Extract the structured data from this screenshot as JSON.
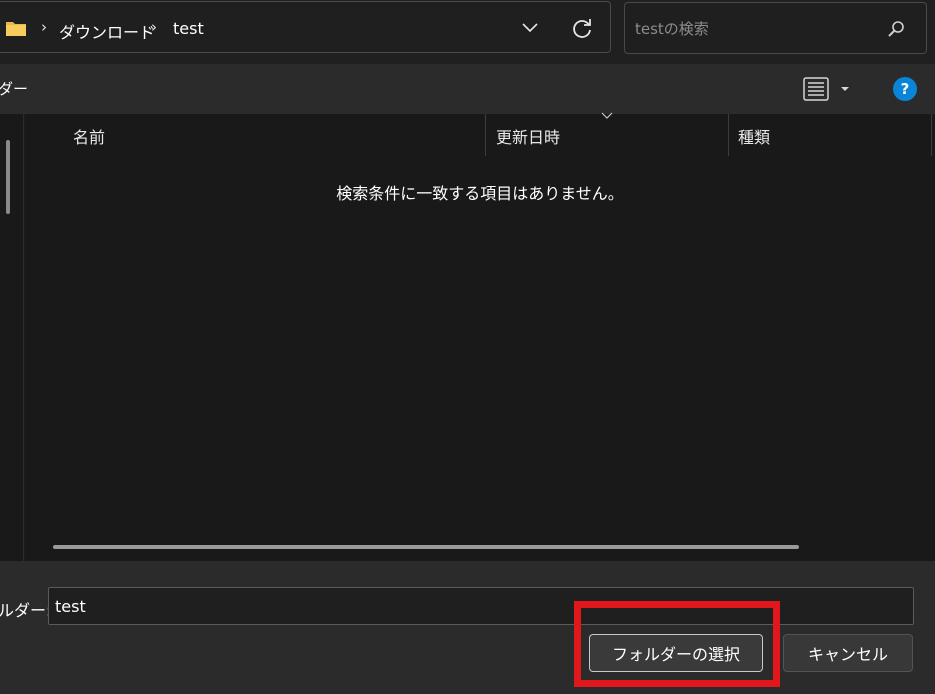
{
  "address_bar": {
    "breadcrumbs": [
      "ダウンロード",
      "test"
    ],
    "separator": "›",
    "folder_icon": "folder-icon",
    "dropdown_icon": "chevron-down-icon",
    "refresh_icon": "refresh-icon"
  },
  "search": {
    "placeholder": "testの検索",
    "icon": "search-icon"
  },
  "toolbar": {
    "label": "ダー",
    "view_icon": "list-view-icon",
    "view_dropdown_icon": "caret-down-icon",
    "help_label": "?",
    "help_color": "#0a84d8"
  },
  "file_list": {
    "columns": [
      "名前",
      "更新日時",
      "種類"
    ],
    "empty_message": "検索条件に一致する項目はありません。"
  },
  "footer": {
    "folder_label": "ルダー:",
    "folder_value": "test",
    "select_button": "フォルダーの選択",
    "cancel_button": "キャンセル",
    "highlight_color": "#e0171b"
  }
}
